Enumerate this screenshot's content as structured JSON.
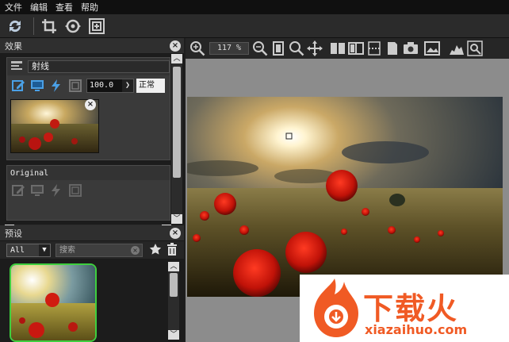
{
  "menu": [
    "文件",
    "编辑",
    "查看",
    "帮助"
  ],
  "toolbar": {
    "icons": [
      "refresh-icon",
      "crop-icon",
      "rotate-icon",
      "fit-icon"
    ]
  },
  "effects_panel": {
    "title": "效果",
    "card1": {
      "name": "射线",
      "amount": "100.0",
      "blend_mode": "正常"
    },
    "card2": {
      "name": "Original"
    }
  },
  "presets_panel": {
    "title": "预设",
    "category": "All",
    "search_placeholder": "搜索"
  },
  "view_toolbar": {
    "zoom": "117 %"
  },
  "watermark": {
    "brand_cn": "下载火",
    "brand_en": "xiazaihuo.com"
  },
  "colors": {
    "accent_green": "#3ecf3e",
    "brand_orange": "#f05a24"
  }
}
